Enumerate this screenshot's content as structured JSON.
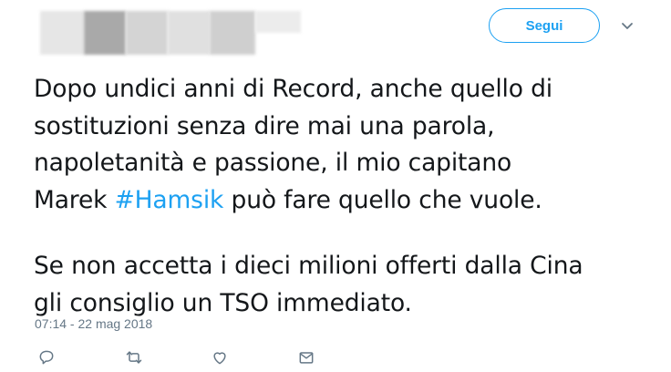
{
  "header": {
    "follow_label": "Segui"
  },
  "tweet": {
    "lines": [
      "Dopo undici anni di Record, anche quello di",
      "sostituzioni senza dire mai una parola,",
      "napoletanità e passione, il mio capitano"
    ],
    "line4_pre": "Marek ",
    "hashtag": "#Hamsik",
    "line4_post": " può fare quello che vuole.",
    "paragraph2": [
      "Se non accetta i dieci milioni offerti dalla Cina",
      "gli consiglio un TSO immediato."
    ],
    "timestamp": "07:14 - 22 mag 2018"
  },
  "actions": {
    "icons": [
      "reply-icon",
      "retweet-icon",
      "like-icon",
      "message-icon"
    ]
  },
  "colors": {
    "accent": "#1da1f2",
    "text": "#14171a",
    "muted": "#657786"
  }
}
